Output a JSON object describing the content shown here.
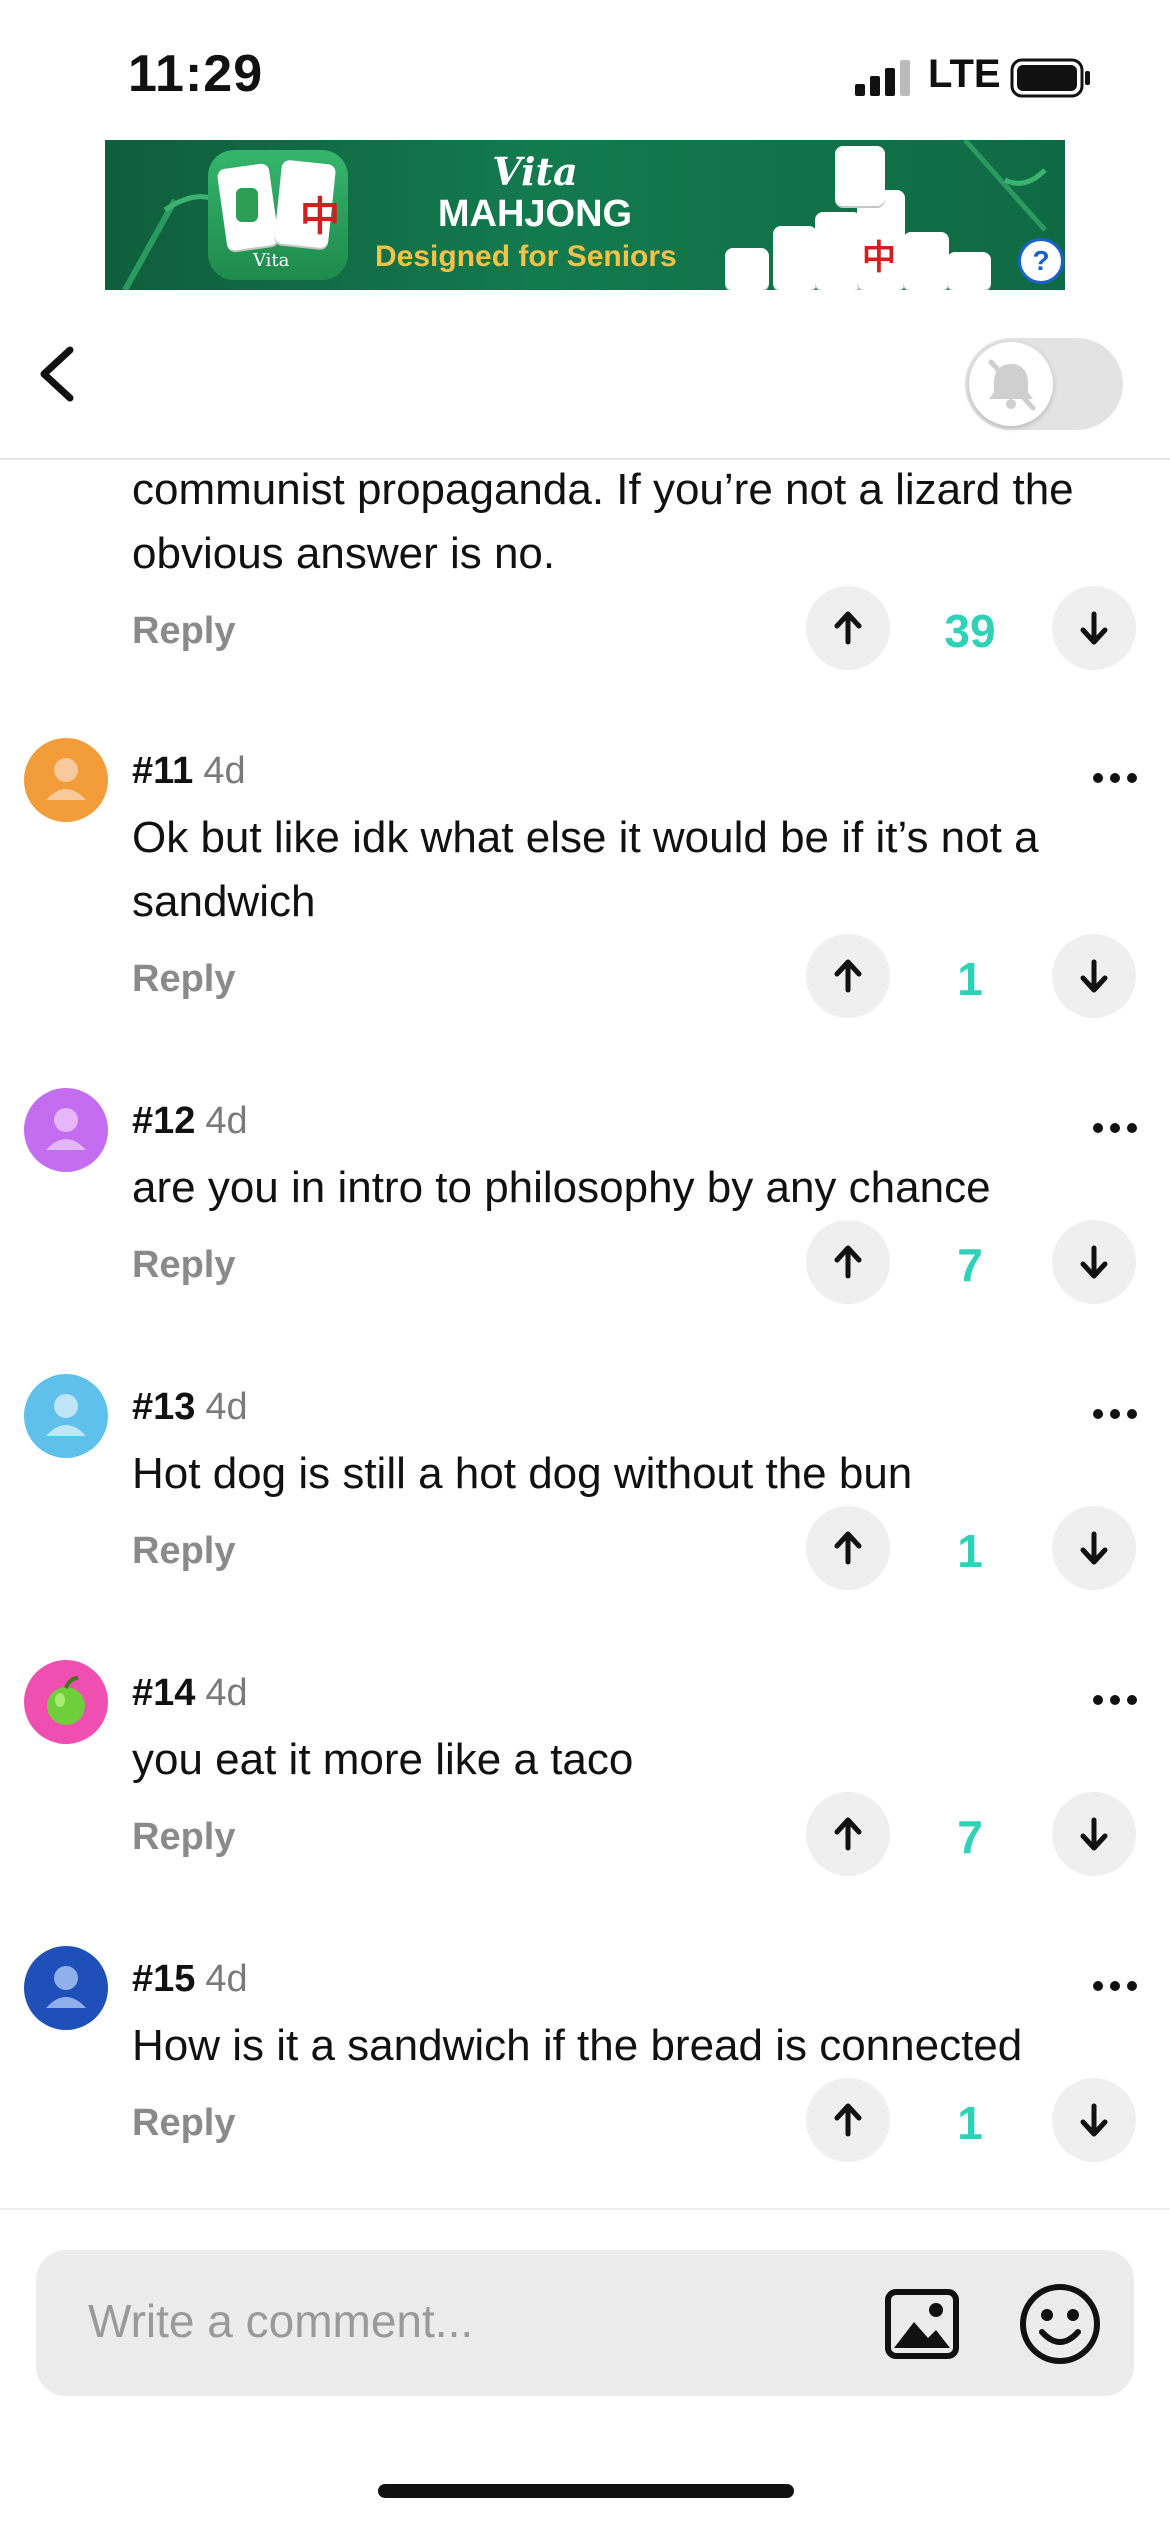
{
  "status": {
    "time": "11:29",
    "network": "LTE"
  },
  "ad": {
    "brand": "Vita",
    "title": "MAHJONG",
    "tagline": "Designed for Seniors",
    "icon_label": "Vita",
    "help_label": "?"
  },
  "header": {
    "notifications_muted": true
  },
  "partial_comment": {
    "text": "communist propaganda. If you’re not a lizard the obvious answer is no.",
    "reply": "Reply",
    "score": "39"
  },
  "comments": [
    {
      "number": "#11",
      "age": "4d",
      "text": "Ok but like idk what else it would be if it’s not a sandwich",
      "reply": "Reply",
      "score": "1",
      "avatar_color": "#f29c3a"
    },
    {
      "number": "#12",
      "age": "4d",
      "text": "are you in intro to philosophy by any chance",
      "reply": "Reply",
      "score": "7",
      "avatar_color": "#c46df0"
    },
    {
      "number": "#13",
      "age": "4d",
      "text": "Hot dog is still a hot dog without the bun",
      "reply": "Reply",
      "score": "1",
      "avatar_color": "#5fc0ec"
    },
    {
      "number": "#14",
      "age": "4d",
      "text": "you eat it more like a taco",
      "reply": "Reply",
      "score": "7",
      "avatar_color": "#ee4fb0",
      "avatar_icon": "green-apple-icon"
    },
    {
      "number": "#15",
      "age": "4d",
      "text": "How is it a sandwich if the bread is connected",
      "reply": "Reply",
      "score": "1",
      "avatar_color": "#1f4fb8"
    }
  ],
  "composer": {
    "placeholder": "Write a comment..."
  },
  "colors": {
    "score": "#2ed2b6",
    "muted_text": "#8a8a8a",
    "ad_green": "#137a4e"
  }
}
